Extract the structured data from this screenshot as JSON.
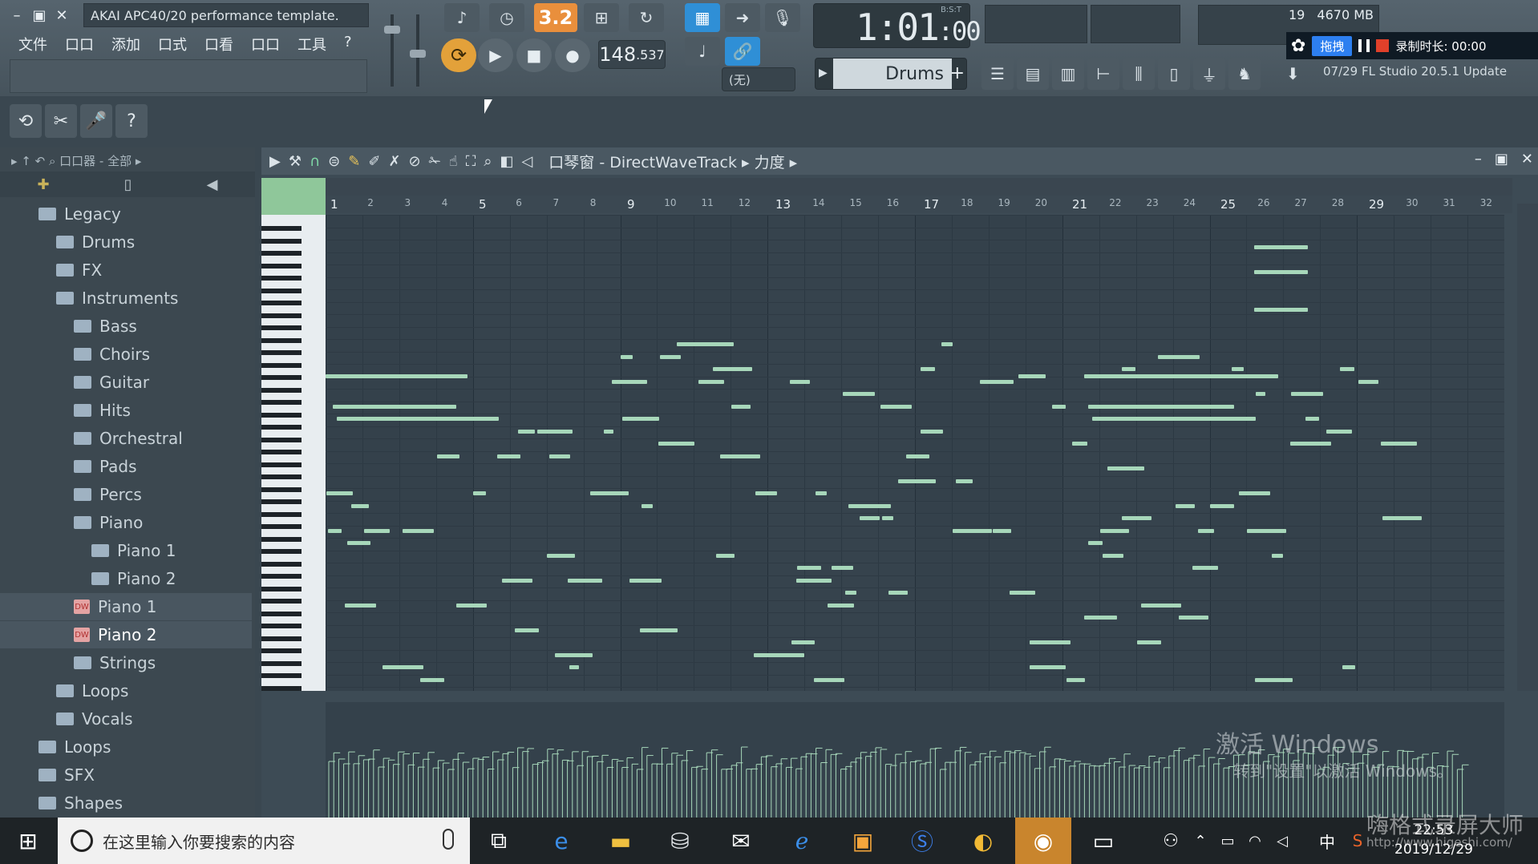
{
  "window": {
    "hint_text": "AKAI APC40/20 performance template.",
    "menu": [
      "文件",
      "口口",
      "添加",
      "口式",
      "口看",
      "口口",
      "工具",
      "?"
    ]
  },
  "transport": {
    "pattern_display": "3.2",
    "tempo_main": "148",
    "tempo_frac": ".537",
    "snap": "(无)",
    "time_main": "1:01",
    "time_sub": ":00",
    "time_label": "B:S:T",
    "pattern_name": "Drums",
    "pattern_add": "+"
  },
  "monitor": {
    "cpu_value": "19",
    "memory": "4670 MB"
  },
  "news": {
    "text": "07/29  FL Studio 20.5.1 Update"
  },
  "recorder": {
    "drag_label": "拖拽",
    "duration_label": "录制时长: 00:00"
  },
  "browser": {
    "header": "口口器 - 全部",
    "items": [
      {
        "label": "Legacy",
        "type": "folder",
        "level": 0
      },
      {
        "label": "Drums",
        "type": "folder",
        "level": 1
      },
      {
        "label": "FX",
        "type": "folder",
        "level": 1
      },
      {
        "label": "Instruments",
        "type": "folder",
        "level": 1
      },
      {
        "label": "Bass",
        "type": "folder",
        "level": 2
      },
      {
        "label": "Choirs",
        "type": "folder",
        "level": 2
      },
      {
        "label": "Guitar",
        "type": "folder",
        "level": 2
      },
      {
        "label": "Hits",
        "type": "folder",
        "level": 2
      },
      {
        "label": "Orchestral",
        "type": "folder",
        "level": 2
      },
      {
        "label": "Pads",
        "type": "folder",
        "level": 2
      },
      {
        "label": "Percs",
        "type": "folder",
        "level": 2
      },
      {
        "label": "Piano",
        "type": "folder",
        "level": 2
      },
      {
        "label": "Piano 1",
        "type": "folder",
        "level": 3
      },
      {
        "label": "Piano 2",
        "type": "folder",
        "level": 3
      },
      {
        "label": "Piano 1",
        "type": "plugin",
        "level": 2
      },
      {
        "label": "Piano 2",
        "type": "plugin",
        "level": 2
      },
      {
        "label": "Strings",
        "type": "folder",
        "level": 2
      },
      {
        "label": "Loops",
        "type": "folder",
        "level": 1
      },
      {
        "label": "Vocals",
        "type": "folder",
        "level": 1
      },
      {
        "label": "Loops",
        "type": "folder",
        "level": 0
      },
      {
        "label": "SFX",
        "type": "folder",
        "level": 0
      },
      {
        "label": "Shapes",
        "type": "folder",
        "level": 0
      }
    ]
  },
  "piano_roll": {
    "title_prefix": "口琴窗",
    "channel": "DirectWaveTrack",
    "target": "力度",
    "bars": [
      "1",
      "2",
      "3",
      "4",
      "5",
      "6",
      "7",
      "8",
      "9",
      "10",
      "11",
      "12",
      "13",
      "14",
      "15",
      "16",
      "17",
      "18",
      "19",
      "20",
      "21",
      "22",
      "23",
      "24",
      "25",
      "26",
      "27",
      "28",
      "29",
      "30",
      "31",
      "32"
    ]
  },
  "taskbar": {
    "search_placeholder": "在这里输入你要搜索的内容",
    "time": "22:53",
    "date": "2019/12/29",
    "ime": "中"
  },
  "overlays": {
    "activate_title": "激活 Windows",
    "activate_sub": "转到\"设置\"以激活 Windows。",
    "recorder_brand": "嗨格式录屏大师",
    "recorder_url": "http://www.higeshi.com/"
  },
  "colors": {
    "note": "#a7d7ba",
    "accent_orange": "#e98f3c",
    "accent_blue": "#2f8fd6",
    "grid_bg": "#34414b"
  }
}
